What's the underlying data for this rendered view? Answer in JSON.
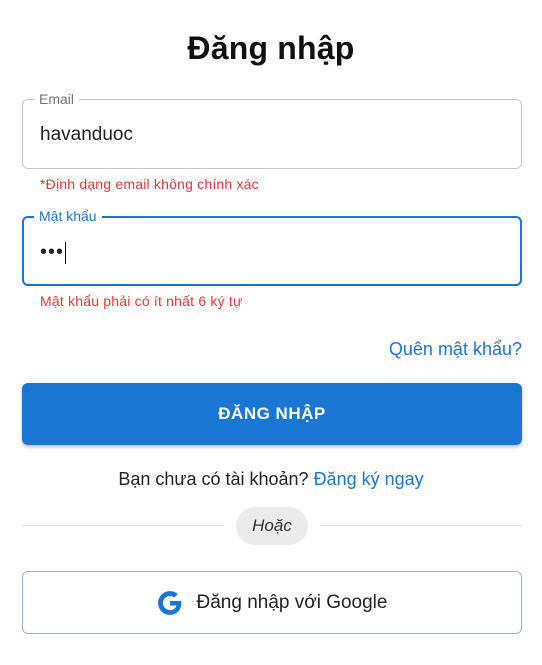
{
  "title": "Đăng nhập",
  "email": {
    "label": "Email",
    "value": "havanduoc",
    "error": "*Định dạng email không chính xác"
  },
  "password": {
    "label": "Mật khẩu",
    "value": "•••",
    "error": "Mật khẩu phải có ít nhất 6 ký tự"
  },
  "forgot_password": "Quên mật khẩu?",
  "login_button": "ĐĂNG NHẬP",
  "signup": {
    "prompt": "Bạn chưa có tài khoản?",
    "link": "Đăng ký ngay"
  },
  "divider_text": "Hoặc",
  "google_button": {
    "label": "Đăng nhập với Google",
    "icon": "google-g-icon"
  },
  "colors": {
    "primary": "#1976d2",
    "error": "#e53935"
  }
}
